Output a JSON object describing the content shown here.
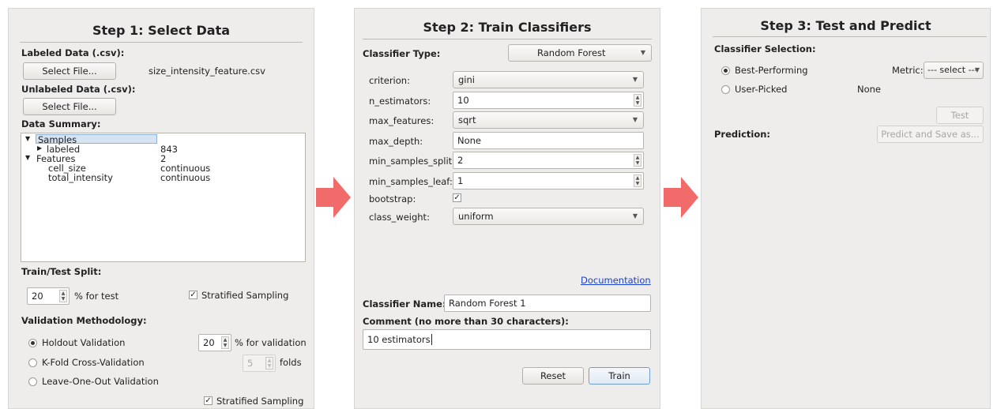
{
  "step1": {
    "title": "Step 1: Select Data",
    "labeled_label": "Labeled Data (.csv):",
    "select_file_1": "Select File...",
    "labeled_filename": "size_intensity_feature.csv",
    "unlabeled_label": "Unlabeled Data (.csv):",
    "select_file_2": "Select File...",
    "summary_label": "Data Summary:",
    "tree": [
      {
        "name": "Samples",
        "value": "",
        "expander": "▼"
      },
      {
        "name": "labeled",
        "value": "843",
        "expander": "▶"
      },
      {
        "name": "Features",
        "value": "2",
        "expander": "▼"
      },
      {
        "name": "cell_size",
        "value": "continuous",
        "expander": ""
      },
      {
        "name": "total_intensity",
        "value": "continuous",
        "expander": ""
      }
    ],
    "split_label": "Train/Test Split:",
    "test_percent": "20",
    "test_suffix": "% for test",
    "stratified_1": "Stratified Sampling",
    "validation_label": "Validation Methodology:",
    "holdout": "Holdout Validation",
    "val_percent": "20",
    "val_suffix": "% for validation",
    "kfold": "K-Fold Cross-Validation",
    "folds_value": "5",
    "folds_suffix": "folds",
    "loo": "Leave-One-Out Validation",
    "stratified_2": "Stratified Sampling"
  },
  "step2": {
    "title": "Step 2: Train Classifiers",
    "type_label": "Classifier Type:",
    "type_value": "Random Forest",
    "params": {
      "criterion_label": "criterion:",
      "criterion_value": "gini",
      "n_estimators_label": "n_estimators:",
      "n_estimators_value": "10",
      "max_features_label": "max_features:",
      "max_features_value": "sqrt",
      "max_depth_label": "max_depth:",
      "max_depth_value": "None",
      "min_samples_split_label": "min_samples_split:",
      "min_samples_split_value": "2",
      "min_samples_leaf_label": "min_samples_leaf:",
      "min_samples_leaf_value": "1",
      "bootstrap_label": "bootstrap:",
      "class_weight_label": "class_weight:",
      "class_weight_value": "uniform"
    },
    "documentation": "Documentation",
    "name_label": "Classifier Name:",
    "name_value": "Random Forest 1",
    "comment_label": "Comment (no more than 30 characters):",
    "comment_value": "10 estimators",
    "reset": "Reset",
    "train": "Train"
  },
  "step3": {
    "title": "Step 3: Test and Predict",
    "selection_label": "Classifier Selection:",
    "best": "Best-Performing",
    "metric_label": "Metric:",
    "metric_value": "--- select ---",
    "user": "User-Picked",
    "user_value": "None",
    "test": "Test",
    "prediction_label": "Prediction:",
    "predict": "Predict and Save as..."
  },
  "colors": {
    "arrow": "#f26b6b",
    "panel": "#efedeb",
    "link": "#1b42c9",
    "selection": "#d5e3f3"
  }
}
